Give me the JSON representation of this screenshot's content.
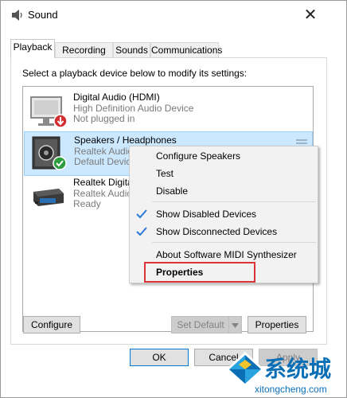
{
  "window": {
    "title": "Sound",
    "close_label": "✕"
  },
  "tabs": [
    "Playback",
    "Recording",
    "Sounds",
    "Communications"
  ],
  "instruction": "Select a playback device below to modify its settings:",
  "devices": [
    {
      "name": "Digital Audio (HDMI)",
      "line2": "High Definition Audio Device",
      "line3": "Not plugged in"
    },
    {
      "name": "Speakers / Headphones",
      "line2": "Realtek Audio",
      "line3": "Default Device"
    },
    {
      "name": "Realtek Digital Output",
      "line2": "Realtek Audio",
      "line3": "Ready"
    }
  ],
  "context_menu": {
    "items": [
      "Configure Speakers",
      "Test",
      "Disable",
      "Show Disabled Devices",
      "Show Disconnected Devices",
      "About Software MIDI Synthesizer",
      "Properties"
    ],
    "checked": [
      false,
      false,
      false,
      true,
      true,
      false,
      false
    ]
  },
  "buttons": {
    "configure": "Configure",
    "set_default": "Set Default",
    "properties": "Properties",
    "ok": "OK",
    "cancel": "Cancel",
    "apply": "Apply"
  },
  "colors": {
    "accent": "#0078d7",
    "selection": "#cce8ff",
    "highlight_box": "#d9343a",
    "logo": "#0b6fb6"
  },
  "watermark": {
    "cn": "系统城",
    "url": "xitongcheng.com"
  }
}
